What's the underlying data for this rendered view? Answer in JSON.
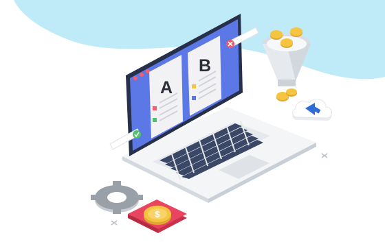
{
  "illustration": {
    "variant_a_label": "A",
    "variant_b_label": "B",
    "currency_symbol": "$"
  },
  "colors": {
    "sky_blob": "#bfeaf8",
    "screen_blue": "#5b78e6",
    "laptop_body": "#eef0f3",
    "laptop_shadow": "#dfe3e8",
    "keyboard_keys": "#3a4766",
    "panel_gray": "#f2f2f4",
    "coin_gold": "#f5c542",
    "tile_red": "#e94560",
    "check_green": "#4fc36c",
    "badge_red": "#ea5a66",
    "gear_gray": "#9aa0a8",
    "arrow_blue": "#2e6cd8"
  },
  "icons": [
    "window-dots-icon",
    "check-badge-icon",
    "x-badge-icon",
    "funnel-icon",
    "coin-icon",
    "cloud-upload-icon",
    "gear-icon",
    "dollar-coin-icon",
    "sparkle-x-icon"
  ]
}
